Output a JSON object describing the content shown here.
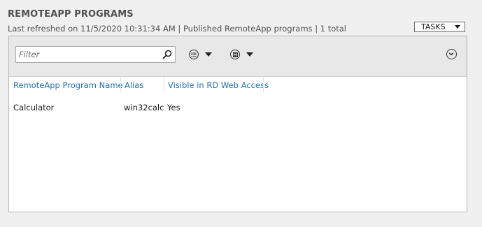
{
  "header": {
    "title": "REMOTEAPP PROGRAMS",
    "subtitle": "Last refreshed on 11/5/2020 10:31:34 AM | Published RemoteApp programs  | 1 total",
    "tasks_label": "TASKS"
  },
  "toolbar": {
    "filter_placeholder": "Filter",
    "filter_value": "",
    "icons": {
      "search": "search-icon",
      "list_options": "list-options-icon",
      "save_query": "save-icon",
      "expand": "chevron-down-circle-icon"
    }
  },
  "table": {
    "columns": [
      "RemoteApp Program Name",
      "Alias",
      "Visible in RD Web Access"
    ],
    "rows": [
      [
        "Calculator",
        "win32calc",
        "Yes"
      ]
    ]
  },
  "colors": {
    "header_link": "#1f6fb5",
    "background": "#f0f0f0",
    "toolbar": "#e8e8e8"
  }
}
